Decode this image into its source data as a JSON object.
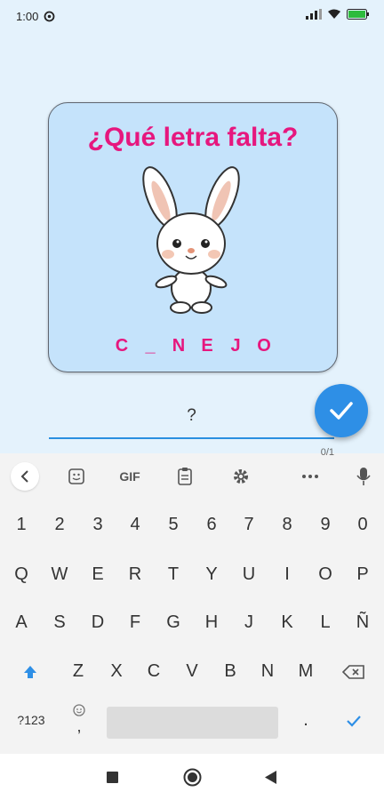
{
  "status": {
    "time": "1:00"
  },
  "card": {
    "title": "¿Qué letra falta?",
    "word_letters": [
      "C",
      "_",
      "N",
      "E",
      "J",
      "O"
    ]
  },
  "answer": {
    "value": "?",
    "counter": "0/1"
  },
  "keyboard": {
    "toolbar": {
      "gif": "GIF"
    },
    "rows": [
      [
        "1",
        "2",
        "3",
        "4",
        "5",
        "6",
        "7",
        "8",
        "9",
        "0"
      ],
      [
        "Q",
        "W",
        "E",
        "R",
        "T",
        "Y",
        "U",
        "I",
        "O",
        "P"
      ],
      [
        "A",
        "S",
        "D",
        "F",
        "G",
        "H",
        "J",
        "K",
        "L",
        "Ñ"
      ],
      [
        "Z",
        "X",
        "C",
        "V",
        "B",
        "N",
        "M"
      ]
    ],
    "symbols_key": "?123",
    "comma_key": ",",
    "period_key": "."
  },
  "colors": {
    "accent": "#e6177e",
    "primary": "#2e8fe6",
    "card_bg": "#c5e3fb"
  },
  "icons": [
    "wifi-icon",
    "signal-icon",
    "battery-icon",
    "check-icon",
    "mic-icon",
    "gear-icon",
    "clipboard-icon",
    "sticker-icon",
    "shift-icon",
    "backspace-icon",
    "emoji-icon",
    "stop-icon",
    "home-icon",
    "back-icon"
  ]
}
